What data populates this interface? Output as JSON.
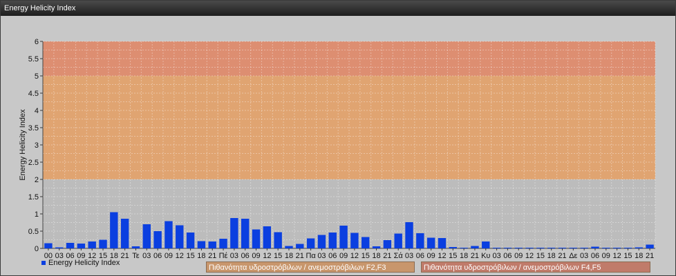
{
  "window": {
    "title": "Energy Helicity Index"
  },
  "legend": {
    "series_name": "Energy Helicity Index",
    "color": "#0b3fe0"
  },
  "zones": [
    {
      "label": "Πιθανότητα υδροστρόβιλων / ανεμοστρόβιλων F2,F3",
      "range": [
        2,
        5
      ],
      "color": "#e3a26a"
    },
    {
      "label": "Πιθανότητα υδροστρόβιλων / ανεμοστρόβιλων F4,F5",
      "range": [
        5,
        6
      ],
      "color": "#e08a6a"
    }
  ],
  "chart_data": {
    "type": "bar",
    "title": "",
    "xlabel": "",
    "ylabel": "Energy Helicity Index",
    "ylim": [
      0,
      6
    ],
    "yticks": [
      "0",
      "0.5",
      "1",
      "1.5",
      "2",
      "2.5",
      "3",
      "3.5",
      "4",
      "4.5",
      "5",
      "5.5",
      "6"
    ],
    "grid": true,
    "legend_position": "bottom-left",
    "categories": [
      "00",
      "03",
      "06",
      "09",
      "12",
      "15",
      "18",
      "21",
      "Τε",
      "03",
      "06",
      "09",
      "12",
      "15",
      "18",
      "21",
      "Πέ",
      "03",
      "06",
      "09",
      "12",
      "15",
      "18",
      "21",
      "Πα",
      "03",
      "06",
      "09",
      "12",
      "15",
      "18",
      "21",
      "Σά",
      "03",
      "06",
      "09",
      "12",
      "15",
      "18",
      "21",
      "Κυ",
      "03",
      "06",
      "09",
      "12",
      "15",
      "18",
      "21",
      "Δε",
      "03",
      "06",
      "09",
      "12",
      "15",
      "18",
      "21"
    ],
    "series": [
      {
        "name": "Energy Helicity Index",
        "color": "#0b3fe0",
        "values": [
          0.15,
          0.03,
          0.16,
          0.14,
          0.2,
          0.25,
          1.05,
          0.86,
          0.06,
          0.7,
          0.5,
          0.79,
          0.67,
          0.46,
          0.21,
          0.2,
          0.28,
          0.88,
          0.86,
          0.55,
          0.64,
          0.47,
          0.07,
          0.13,
          0.29,
          0.39,
          0.46,
          0.66,
          0.45,
          0.33,
          0.06,
          0.24,
          0.43,
          0.76,
          0.44,
          0.31,
          0.3,
          0.04,
          0.02,
          0.07,
          0.2,
          0.02,
          0.02,
          0.02,
          0.02,
          0.02,
          0.02,
          0.02,
          0.02,
          0.02,
          0.05,
          0.02,
          0.02,
          0.02,
          0.03,
          0.11
        ]
      }
    ]
  }
}
